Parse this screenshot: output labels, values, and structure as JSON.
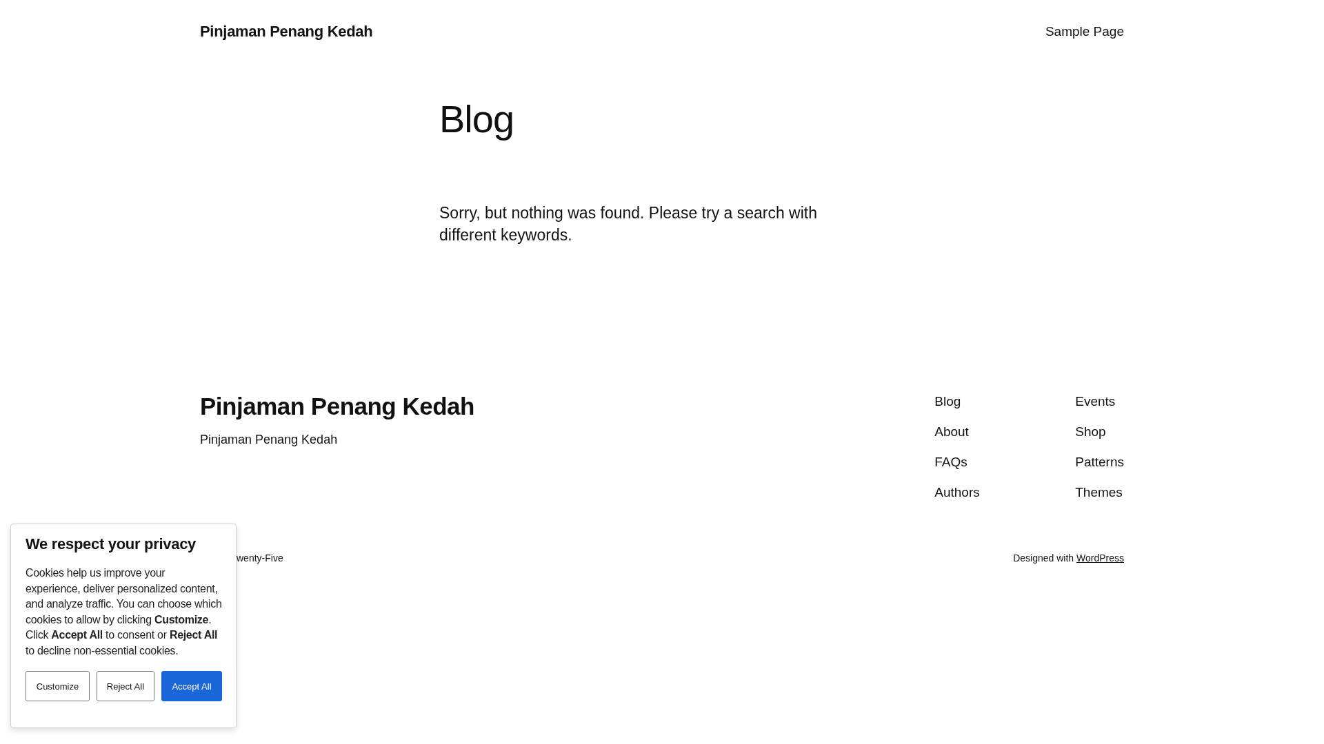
{
  "header": {
    "site_title": "Pinjaman Penang Kedah",
    "nav": [
      "Sample Page"
    ]
  },
  "main": {
    "heading": "Blog",
    "message": "Sorry, but nothing was found. Please try a search with different keywords."
  },
  "footer": {
    "site_title": "Pinjaman Penang Kedah",
    "tagline": "Pinjaman Penang Kedah",
    "nav_columns": [
      [
        "Blog",
        "About",
        "FAQs",
        "Authors"
      ],
      [
        "Events",
        "Shop",
        "Patterns",
        "Themes"
      ]
    ],
    "credit_left": "wenty-Five",
    "credit_right": {
      "text": "Designed with",
      "link": "WordPress"
    }
  },
  "cookie_banner": {
    "title": "We respect your privacy",
    "body": "Cookies help us improve your experience, deliver personalized content, and analyze traffic. You can choose which cookies to allow by clicking **Customize**. Click **Accept All** to consent or **Reject All** to decline non-essential cookies.",
    "buttons": [
      {
        "label": "Customize",
        "kind": "outline"
      },
      {
        "label": "Reject All",
        "kind": "outline"
      },
      {
        "label": "Accept All",
        "kind": "primary"
      }
    ]
  }
}
